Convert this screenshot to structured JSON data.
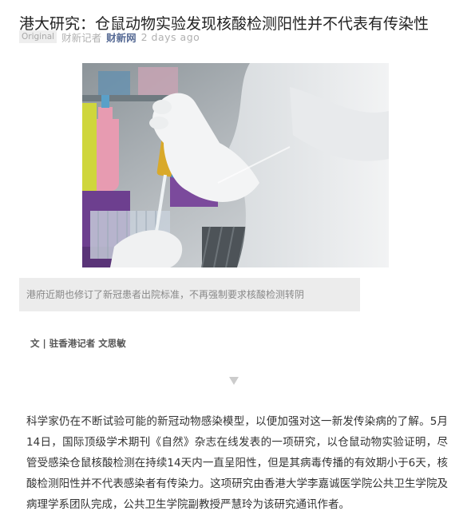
{
  "article": {
    "title": "港大研究：仓鼠动物实验发现核酸检测阳性并不代表有传染性",
    "original_badge": "Original",
    "author": "财新记者",
    "account": "财新网",
    "time": "2 days ago"
  },
  "photo": {
    "icon": "lab-photo"
  },
  "caption": "港府近期也修订了新冠患者出院标准，不再强制要求核酸检测转阴",
  "byline": "文 | 驻香港记者 文思敏",
  "divider_icon": "down-triangle-icon",
  "body": "科学家仍在不断试验可能的新冠动物感染模型，以便加强对这一新发传染病的了解。5月14日，国际顶级学术期刊《自然》杂志在线发表的一项研究，以仓鼠动物实验证明，尽管受感染仓鼠核酸检测在持续14天内一直呈阳性，但是其病毒传播的有效期小于6天，核酸检测阳性并不代表感染者有传染力。这项研究由香港大学李嘉诚医学院公共卫生学院及病理学系团队完成，公共卫生学院副教授严慧玲为该研究通讯作者。",
  "colors": {
    "account": "#576b95",
    "caption_bg": "#ececec"
  }
}
